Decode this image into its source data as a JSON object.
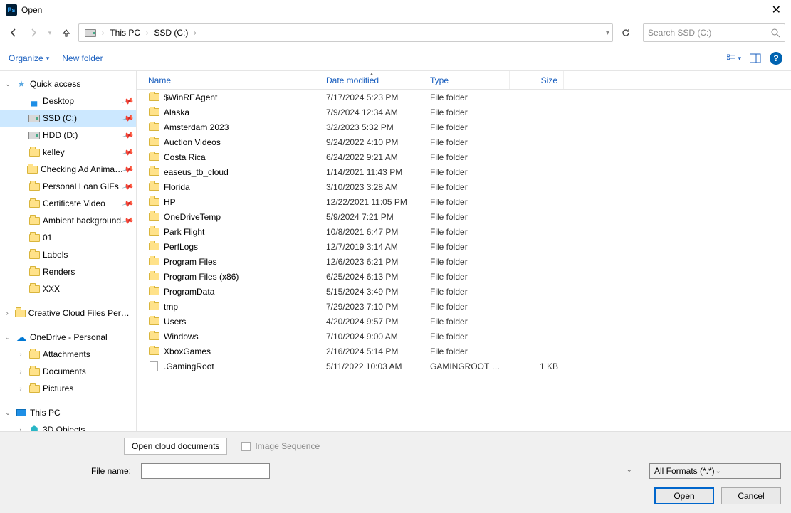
{
  "title": "Open",
  "app_icon": "Ps",
  "nav": {
    "back": "←",
    "forward": "→",
    "up": "↑"
  },
  "breadcrumbs": [
    "This PC",
    "SSD (C:)"
  ],
  "search_placeholder": "Search SSD (C:)",
  "toolbar": {
    "organize": "Organize",
    "new_folder": "New folder"
  },
  "tree": [
    {
      "ind": 0,
      "tw": "v",
      "icon": "star",
      "label": "Quick access",
      "pin": false,
      "sel": false
    },
    {
      "ind": 1,
      "tw": "",
      "icon": "desktop",
      "label": "Desktop",
      "pin": true,
      "sel": false
    },
    {
      "ind": 1,
      "tw": "",
      "icon": "drive",
      "label": "SSD (C:)",
      "pin": true,
      "sel": true
    },
    {
      "ind": 1,
      "tw": "",
      "icon": "drive",
      "label": "HDD (D:)",
      "pin": true,
      "sel": false
    },
    {
      "ind": 1,
      "tw": "",
      "icon": "folder",
      "label": "kelley",
      "pin": true,
      "sel": false
    },
    {
      "ind": 1,
      "tw": "",
      "icon": "folder",
      "label": "Checking Ad Animation",
      "pin": true,
      "sel": false
    },
    {
      "ind": 1,
      "tw": "",
      "icon": "folder",
      "label": "Personal Loan GIFs",
      "pin": true,
      "sel": false
    },
    {
      "ind": 1,
      "tw": "",
      "icon": "folder",
      "label": "Certificate Video",
      "pin": true,
      "sel": false
    },
    {
      "ind": 1,
      "tw": "",
      "icon": "folder",
      "label": "Ambient background",
      "pin": true,
      "sel": false
    },
    {
      "ind": 1,
      "tw": "",
      "icon": "folder",
      "label": "01",
      "pin": false,
      "sel": false
    },
    {
      "ind": 1,
      "tw": "",
      "icon": "folder",
      "label": "Labels",
      "pin": false,
      "sel": false
    },
    {
      "ind": 1,
      "tw": "",
      "icon": "folder",
      "label": "Renders",
      "pin": false,
      "sel": false
    },
    {
      "ind": 1,
      "tw": "",
      "icon": "folder",
      "label": "XXX",
      "pin": false,
      "sel": false
    },
    {
      "ind": 0,
      "tw": ">",
      "icon": "folder",
      "label": "Creative Cloud Files Personal",
      "pin": false,
      "sel": false,
      "gap": true
    },
    {
      "ind": 0,
      "tw": "v",
      "icon": "onedrive",
      "label": "OneDrive - Personal",
      "pin": false,
      "sel": false,
      "gap": true
    },
    {
      "ind": 1,
      "tw": ">",
      "icon": "folder",
      "label": "Attachments",
      "pin": false,
      "sel": false
    },
    {
      "ind": 1,
      "tw": ">",
      "icon": "folder",
      "label": "Documents",
      "pin": false,
      "sel": false
    },
    {
      "ind": 1,
      "tw": ">",
      "icon": "folder",
      "label": "Pictures",
      "pin": false,
      "sel": false
    },
    {
      "ind": 0,
      "tw": "v",
      "icon": "pc",
      "label": "This PC",
      "pin": false,
      "sel": false,
      "gap": true
    },
    {
      "ind": 1,
      "tw": ">",
      "icon": "3d",
      "label": "3D Objects",
      "pin": false,
      "sel": false
    }
  ],
  "columns": {
    "name": "Name",
    "date": "Date modified",
    "type": "Type",
    "size": "Size"
  },
  "rows": [
    {
      "icon": "folder",
      "name": "$WinREAgent",
      "date": "7/17/2024 5:23 PM",
      "type": "File folder",
      "size": ""
    },
    {
      "icon": "folder",
      "name": "Alaska",
      "date": "7/9/2024 12:34 AM",
      "type": "File folder",
      "size": ""
    },
    {
      "icon": "folder",
      "name": "Amsterdam 2023",
      "date": "3/2/2023 5:32 PM",
      "type": "File folder",
      "size": ""
    },
    {
      "icon": "folder",
      "name": "Auction Videos",
      "date": "9/24/2022 4:10 PM",
      "type": "File folder",
      "size": ""
    },
    {
      "icon": "folder",
      "name": "Costa Rica",
      "date": "6/24/2022 9:21 AM",
      "type": "File folder",
      "size": ""
    },
    {
      "icon": "folder",
      "name": "easeus_tb_cloud",
      "date": "1/14/2021 11:43 PM",
      "type": "File folder",
      "size": ""
    },
    {
      "icon": "folder",
      "name": "Florida",
      "date": "3/10/2023 3:28 AM",
      "type": "File folder",
      "size": ""
    },
    {
      "icon": "folder",
      "name": "HP",
      "date": "12/22/2021 11:05 PM",
      "type": "File folder",
      "size": ""
    },
    {
      "icon": "folder",
      "name": "OneDriveTemp",
      "date": "5/9/2024 7:21 PM",
      "type": "File folder",
      "size": ""
    },
    {
      "icon": "folder",
      "name": "Park Flight",
      "date": "10/8/2021 6:47 PM",
      "type": "File folder",
      "size": ""
    },
    {
      "icon": "folder",
      "name": "PerfLogs",
      "date": "12/7/2019 3:14 AM",
      "type": "File folder",
      "size": ""
    },
    {
      "icon": "folder",
      "name": "Program Files",
      "date": "12/6/2023 6:21 PM",
      "type": "File folder",
      "size": ""
    },
    {
      "icon": "folder",
      "name": "Program Files (x86)",
      "date": "6/25/2024 6:13 PM",
      "type": "File folder",
      "size": ""
    },
    {
      "icon": "folder",
      "name": "ProgramData",
      "date": "5/15/2024 3:49 PM",
      "type": "File folder",
      "size": ""
    },
    {
      "icon": "folder",
      "name": "tmp",
      "date": "7/29/2023 7:10 PM",
      "type": "File folder",
      "size": ""
    },
    {
      "icon": "folder",
      "name": "Users",
      "date": "4/20/2024 9:57 PM",
      "type": "File folder",
      "size": ""
    },
    {
      "icon": "folder",
      "name": "Windows",
      "date": "7/10/2024 9:00 AM",
      "type": "File folder",
      "size": ""
    },
    {
      "icon": "folder",
      "name": "XboxGames",
      "date": "2/16/2024 5:14 PM",
      "type": "File folder",
      "size": ""
    },
    {
      "icon": "file",
      "name": ".GamingRoot",
      "date": "5/11/2022 10:03 AM",
      "type": "GAMINGROOT File",
      "size": "1 KB"
    }
  ],
  "footer": {
    "ocd": "Open cloud documents",
    "image_seq": "Image Sequence",
    "file_name_label": "File name:",
    "format": "All Formats (*.*)",
    "open": "Open",
    "cancel": "Cancel"
  }
}
